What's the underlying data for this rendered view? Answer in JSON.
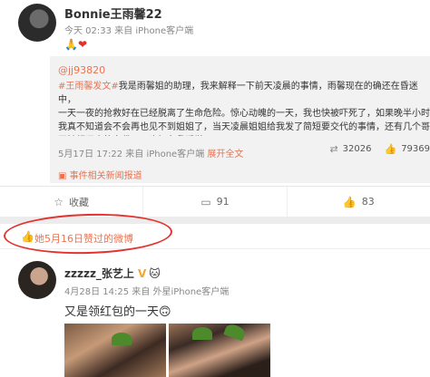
{
  "post1": {
    "username": "Bonnie王雨馨22",
    "meta": "今天 02:33 来自 iPhone客户端",
    "emoji": "🙏❤",
    "repost": {
      "user": "@jj93820",
      "tag": "#王雨馨发文#",
      "body": "我是雨馨姐的助理，我来解释一下前天凌晨的事情，雨馨现在的确还在昏迷中，\n一天一夜的抢救好在已经脱离了生命危险。惊心动魄的一天，我也快被吓死了，如果晚半小时\n我真不知道会不会再也见不到姐姐了，当天凌晨姐姐给我发了简短要交代的事情，还有几个哥\n哥她都逐步的交代了，也好在我睡觉 ... ",
      "more": "展开全文",
      "meta": "5月17日 17:22 来自 iPhone客户端",
      "stats": {
        "reposts": "32026",
        "likes": "79369"
      }
    },
    "topic": "事件相关新闻报道",
    "actions": {
      "favorite": "收藏",
      "comment": "91",
      "like": "83"
    }
  },
  "liked_bar": {
    "text": "她5月16日赞过的微博"
  },
  "post2": {
    "username": "zzzzz_张艺上",
    "badge": "V",
    "name_emoji": "🐱",
    "meta": "4月28日 14:25 来自 外星iPhone客户端",
    "text": "又是领红包的一天🙃"
  },
  "colors": {
    "accent": "#eb7350",
    "highlight_circle": "#e3322d",
    "repost_bg": "#f2f2f2"
  },
  "icons": {
    "liked": "thumb-up-icon",
    "repost": "repost-icon",
    "comment": "comment-icon",
    "like": "like-icon",
    "favorite": "star-icon",
    "news": "news-icon"
  }
}
